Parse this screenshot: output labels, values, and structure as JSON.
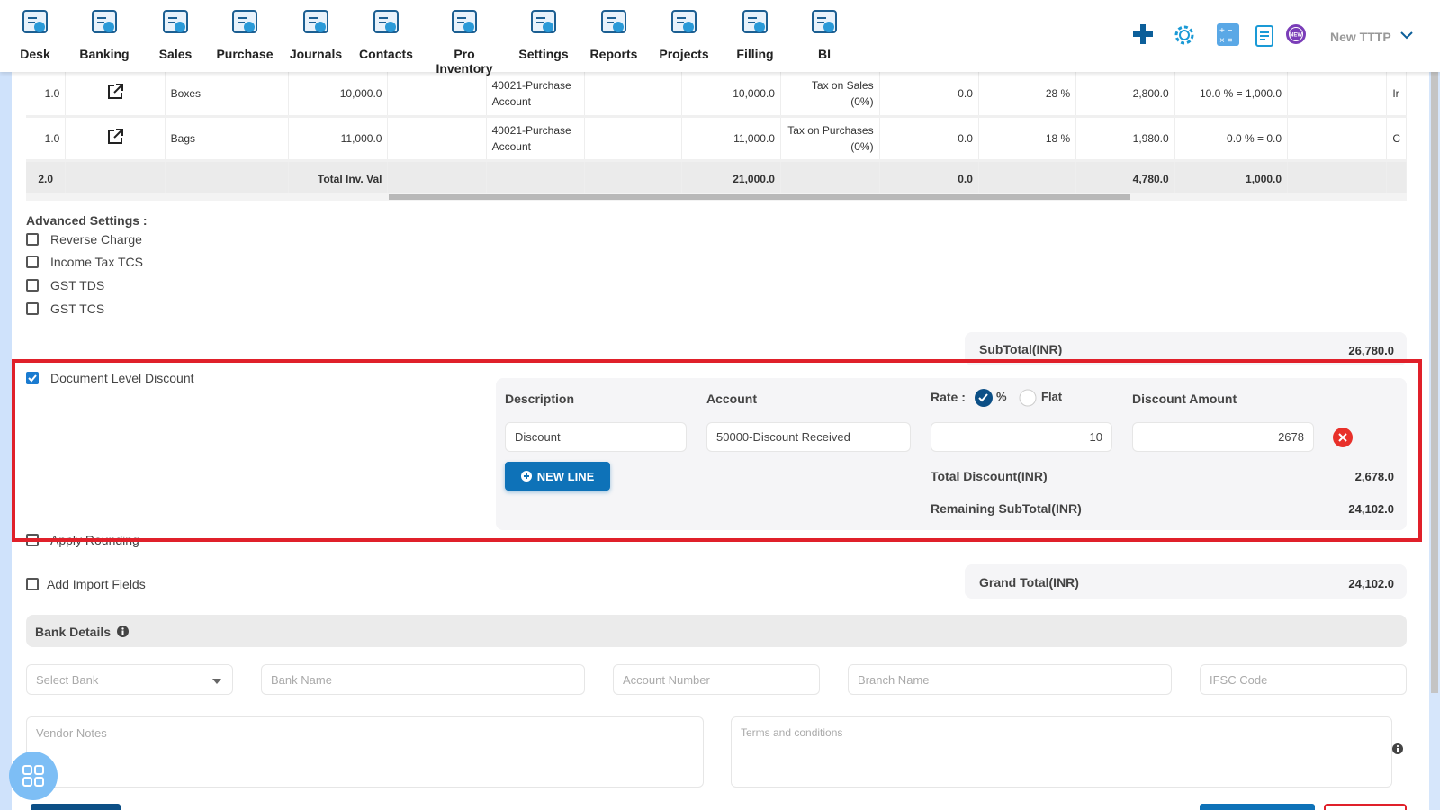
{
  "nav": [
    {
      "label": "Desk",
      "icon": "desk-icon"
    },
    {
      "label": "Banking",
      "icon": "bank-icon"
    },
    {
      "label": "Sales",
      "icon": "sales-icon"
    },
    {
      "label": "Purchase",
      "icon": "purchase-icon"
    },
    {
      "label": "Journals",
      "icon": "journals-icon"
    },
    {
      "label": "Contacts",
      "icon": "contacts-icon"
    },
    {
      "label": "Pro Inventory",
      "icon": "inventory-icon"
    },
    {
      "label": "Settings",
      "icon": "settings-tools-icon"
    },
    {
      "label": "Reports",
      "icon": "reports-icon"
    },
    {
      "label": "Projects",
      "icon": "projects-icon"
    },
    {
      "label": "Filling",
      "icon": "filing-icon"
    },
    {
      "label": "BI",
      "icon": "bi-icon"
    }
  ],
  "topbar": {
    "user": "New TTTP",
    "new_badge": "NEW"
  },
  "table": {
    "rows": [
      [
        "1.0",
        "",
        "Boxes",
        "10,000.0",
        "",
        "40021-Purchase Account",
        "",
        "10,000.0",
        "Tax on Sales (0%)",
        "0.0",
        "28 %",
        "2,800.0",
        "10.0 % = 1,000.0",
        "",
        "Ir"
      ],
      [
        "1.0",
        "",
        "Bags",
        "11,000.0",
        "",
        "40021-Purchase Account",
        "",
        "11,000.0",
        "Tax on Purchases (0%)",
        "0.0",
        "18 %",
        "1,980.0",
        "0.0 % = 0.0",
        "",
        "C"
      ]
    ],
    "total": {
      "qty": "2.0",
      "label": "Total Inv. Val",
      "amount": "21,000.0",
      "c9": "0.0",
      "tax": "4,780.0",
      "discount": "1,000.0"
    }
  },
  "advanced": {
    "title": "Advanced Settings :",
    "options": [
      "Reverse Charge",
      "Income Tax TCS",
      "GST TDS",
      "GST TCS"
    ]
  },
  "subtotal": {
    "label": "SubTotal(INR)",
    "value": "26,780.0"
  },
  "discount": {
    "checkbox_label": "Document Level Discount",
    "checked": true,
    "headers": {
      "description": "Description",
      "account": "Account",
      "rate": "Rate :",
      "percent": "%",
      "flat": "Flat",
      "amount": "Discount Amount"
    },
    "rate_mode": "%",
    "line": {
      "description": "Discount",
      "account": "50000-Discount Received",
      "rate": "10",
      "amount": "2678"
    },
    "new_line": "NEW LINE",
    "total_label": "Total Discount(INR)",
    "total_value": "2,678.0",
    "remaining_label": "Remaining SubTotal(INR)",
    "remaining_value": "24,102.0"
  },
  "apply_rounding": "Apply Rounding",
  "import_fields": "Add Import Fields",
  "grand_total": {
    "label": "Grand Total(INR)",
    "value": "24,102.0"
  },
  "bank": {
    "title": "Bank Details",
    "select_placeholder": "Select Bank",
    "bank_name": "Bank Name",
    "account_number": "Account Number",
    "branch_name": "Branch Name",
    "ifsc": "IFSC Code"
  },
  "notes": {
    "vendor": "Vendor Notes",
    "terms": "Terms and conditions"
  },
  "colors": {
    "brand": "#0e72b8",
    "highlight": "#e0202a",
    "danger": "#e8302a"
  }
}
